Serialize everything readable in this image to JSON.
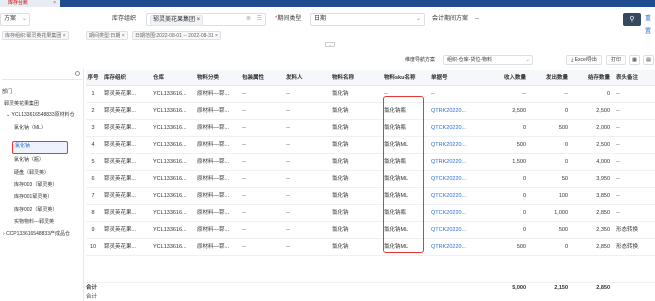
{
  "top_tab": {
    "label": "库存台账",
    "close": "×"
  },
  "filter": {
    "chip_left": "方案",
    "org_label": "库存组织",
    "org_chip": "郓灵美花果集团 ×",
    "period_type_label": "期间类型",
    "period_type_value": "日期",
    "fiscal_period_label": "会计期间方案",
    "fiscal_period_value": "--",
    "query_button_icon": "search-icon",
    "more_text": "重置"
  },
  "tags": [
    "库存组织:郓灵英花果集团 ×",
    "期间类型:日期 ×",
    "日期范围:2022-08-01 -- 2022-08-31 ×"
  ],
  "toolbar": {
    "scheme_label": "维度导航方案",
    "scheme_value": "组织-仓库-货位-物料",
    "export_label": "Excel导出",
    "print_label": "打印"
  },
  "tree": {
    "items": [
      {
        "label": "部门",
        "indent": 0
      },
      {
        "label": "郓灵英花果集团",
        "indent": 1
      },
      {
        "label": "YCL133616548833原材料仓",
        "indent": 1
      },
      {
        "label": "氯化钠（ML）",
        "indent": 3
      },
      {
        "label": "氯化钠",
        "indent": 3,
        "selected": true
      },
      {
        "label": "氯化钠（瓶）",
        "indent": 3
      },
      {
        "label": "硬盘（郓灵英）",
        "indent": 3
      },
      {
        "label": "库存003（郓灵英）",
        "indent": 3
      },
      {
        "label": "库存001郓灵英）",
        "indent": 3
      },
      {
        "label": "库存002（郓灵英）",
        "indent": 3
      },
      {
        "label": "实物物料---郓灵英",
        "indent": 3
      },
      {
        "label": "CCP133616548833产成品仓",
        "indent": 1
      }
    ]
  },
  "table": {
    "headers": [
      "序号",
      "库存组织",
      "仓库",
      "物料分类",
      "包装属性",
      "发料人",
      "物料名称",
      "物料sku名称",
      "单据号",
      "收入数量",
      "发出数量",
      "结存数量",
      "表头备注"
    ],
    "rows": [
      [
        "1",
        "郓灵英花果...",
        "YCL133616...",
        "原材料—郓...",
        "--",
        "--",
        "氯化钠",
        "--",
        "--",
        "--",
        "--",
        "0",
        "--"
      ],
      [
        "2",
        "郓灵英花果...",
        "YCL133616...",
        "原材料—郓...",
        "--",
        "--",
        "氯化钠",
        "氯化钠瓶",
        "QTRK20220...",
        "2,500",
        "0",
        "2,500",
        "--"
      ],
      [
        "3",
        "郓灵英花果...",
        "YCL133616...",
        "原材料—郓...",
        "--",
        "--",
        "氯化钠",
        "氯化钠瓶",
        "QTCK20220...",
        "0",
        "500",
        "2,000",
        "--"
      ],
      [
        "4",
        "郓灵英花果...",
        "YCL133616...",
        "原材料—郓...",
        "--",
        "--",
        "氯化钠",
        "氯化钠ML",
        "QTRK20220...",
        "500",
        "0",
        "2,500",
        "--"
      ],
      [
        "5",
        "郓灵英花果...",
        "YCL133616...",
        "原材料—郓...",
        "--",
        "--",
        "氯化钠",
        "氯化钠瓶",
        "QTRK20220...",
        "1,500",
        "0",
        "4,000",
        "--"
      ],
      [
        "6",
        "郓灵英花果...",
        "YCL133616...",
        "原材料—郓...",
        "--",
        "--",
        "氯化钠",
        "氯化钠ML",
        "QTCK20220...",
        "0",
        "50",
        "3,950",
        "--"
      ],
      [
        "7",
        "郓灵英花果...",
        "YCL133616...",
        "原材料—郓...",
        "--",
        "--",
        "氯化钠",
        "氯化钠ML",
        "QTCK20220...",
        "0",
        "100",
        "3,850",
        "--"
      ],
      [
        "8",
        "郓灵英花果...",
        "YCL133616...",
        "原材料—郓...",
        "--",
        "--",
        "氯化钠",
        "氯化钠瓶",
        "QTCK20220...",
        "0",
        "1,000",
        "2,850",
        "--"
      ],
      [
        "9",
        "郓灵英花果...",
        "YCL133616...",
        "原材料—郓...",
        "--",
        "--",
        "氯化钠",
        "氯化钠ML",
        "QTCK20220...",
        "0",
        "500",
        "2,350",
        "形态转换"
      ],
      [
        "10",
        "郓灵英花果...",
        "YCL133616...",
        "原材料—郓...",
        "--",
        "--",
        "氯化钠",
        "氯化钠ML",
        "QTRK20220...",
        "500",
        "0",
        "2,850",
        "形态转换"
      ]
    ],
    "total_label": "合计",
    "total_in": "5,000",
    "total_out": "2,150",
    "total_balance": "2,850",
    "total2_label": "合计"
  },
  "colors": {
    "accent": "#2b6fd6",
    "highlight": "#e53935",
    "header_bar": "#1f4d8f"
  }
}
